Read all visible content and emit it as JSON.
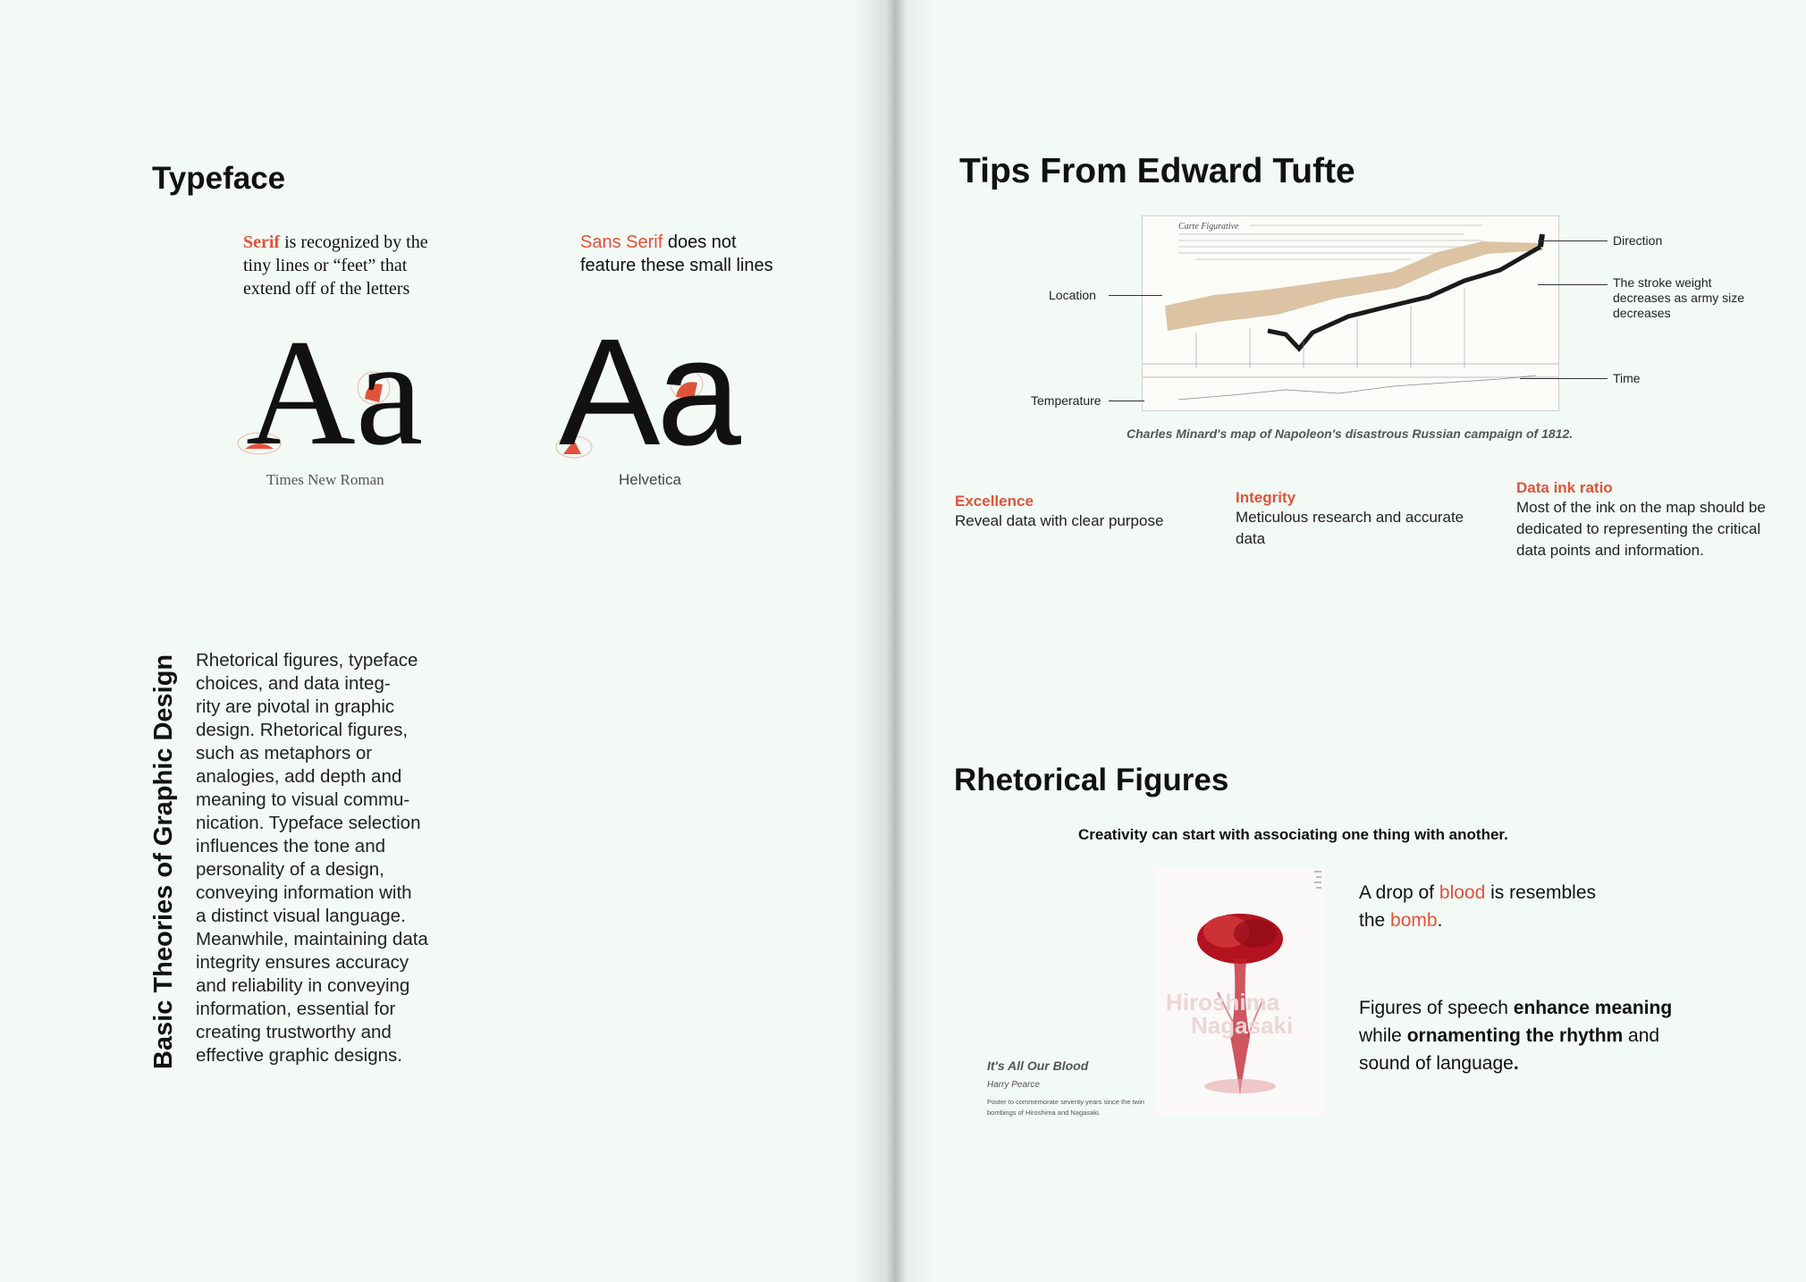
{
  "left": {
    "heading": "Typeface",
    "serif": {
      "word": "Serif",
      "text": " is recognized by the tiny lines or “feet” that extend off of the letters",
      "glyphs": "Aa",
      "caption": "Times New Roman"
    },
    "sans": {
      "word": "Sans Serif",
      "text": " does not feature these small lines",
      "glyphs": "Aa",
      "caption": "Helvetica"
    },
    "section_title": "Basic Theories of Graphic Design",
    "body_lines": [
      "Rhetorical figures, typeface",
      "choices, and data integ-",
      "rity are pivotal in graphic",
      "design. Rhetorical figures,",
      "such as metaphors or",
      "analogies, add depth and",
      "meaning to visual commu-",
      "nication. Typeface selection",
      "influences the tone and",
      "personality of a design,",
      "conveying information with",
      "a distinct visual language.",
      "Meanwhile, maintaining data",
      "integrity ensures accuracy",
      "and reliability in conveying",
      "information, essential for",
      "creating trustworthy and",
      "effective graphic designs."
    ]
  },
  "right": {
    "heading": "Tips From Edward Tufte",
    "map": {
      "title": "Carte Figurative",
      "annotations": {
        "direction": "Direction",
        "stroke": [
          "The stroke weight",
          "decreases as army size",
          "decreases"
        ],
        "location": "Location",
        "time": "Time",
        "temperature": "Temperature"
      },
      "caption": "Charles Minard's map of Napoleon's disastrous Russian campaign of 1812."
    },
    "tips": [
      {
        "title": "Excellence",
        "body": "Reveal data with clear purpose"
      },
      {
        "title": "Integrity",
        "body": "Meticulous research and accurate data"
      },
      {
        "title": "Data ink ratio",
        "body": "Most of the ink on the map should be dedicated to representing the critical data points and information."
      }
    ],
    "rhetorical": {
      "heading": "Rhetorical Figures",
      "subheading": "Creativity can start with associating one thing with another.",
      "poster": {
        "overlay": [
          "Hiroshima",
          "Nagasaki"
        ],
        "title": "It's All Our Blood",
        "author": "Harry Pearce",
        "description": "Poster to commemorate seventy years since the twin bombings of Hiroshima and Nagasaki."
      },
      "line1": {
        "a": "A drop of ",
        "b": "blood",
        "c": " is resembles the ",
        "d": "bomb",
        "e": "."
      },
      "line2": {
        "a": "Figures of speech ",
        "b": "enhance meaning",
        "c": " while ",
        "d": "ornamenting the rhythm",
        "e": " and sound of language",
        "f": "."
      }
    }
  },
  "colors": {
    "accent": "#e0533b",
    "paper": "#f3f9f4",
    "map_tan": "#dcc3a3"
  }
}
